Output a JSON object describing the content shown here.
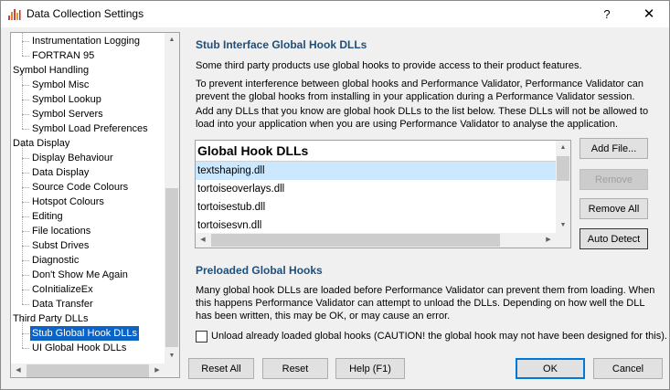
{
  "window": {
    "title": "Data Collection Settings",
    "help_glyph": "?",
    "close_glyph": "✕"
  },
  "tree": {
    "items": [
      {
        "label": "Instrumentation Logging",
        "level": 1
      },
      {
        "label": "FORTRAN 95",
        "level": 1
      },
      {
        "label": "Symbol Handling",
        "level": 0
      },
      {
        "label": "Symbol Misc",
        "level": 1
      },
      {
        "label": "Symbol Lookup",
        "level": 1
      },
      {
        "label": "Symbol Servers",
        "level": 1
      },
      {
        "label": "Symbol Load Preferences",
        "level": 1
      },
      {
        "label": "Data Display",
        "level": 0
      },
      {
        "label": "Display Behaviour",
        "level": 1
      },
      {
        "label": "Data Display",
        "level": 1
      },
      {
        "label": "Source Code Colours",
        "level": 1
      },
      {
        "label": "Hotspot Colours",
        "level": 1
      },
      {
        "label": "Editing",
        "level": 1
      },
      {
        "label": "File locations",
        "level": 1
      },
      {
        "label": "Subst Drives",
        "level": 1
      },
      {
        "label": "Diagnostic",
        "level": 1
      },
      {
        "label": "Don't Show Me Again",
        "level": 1
      },
      {
        "label": "CoInitializeEx",
        "level": 1
      },
      {
        "label": "Data Transfer",
        "level": 1
      },
      {
        "label": "Third Party DLLs",
        "level": 0
      },
      {
        "label": "Stub Global Hook DLLs",
        "level": 1,
        "selected": true
      },
      {
        "label": "UI Global Hook DLLs",
        "level": 1
      }
    ]
  },
  "stub": {
    "title": "Stub Interface Global Hook DLLs",
    "para1": "Some third party products use global hooks to provide access to their product features.",
    "para2": "To prevent interference between global hooks and Performance Validator, Performance Validator can prevent the global hooks from installing in your application during a Performance Validator session.",
    "para3": "Add any DLLs that you know are global hook DLLs to the list below. These DLLs will not be allowed to load into your application when you are using Performance Validator to analyse the application."
  },
  "list": {
    "header": "Global Hook DLLs",
    "rows": [
      "textshaping.dll",
      "tortoiseoverlays.dll",
      "tortoisestub.dll",
      "tortoisesvn.dll"
    ]
  },
  "buttons": {
    "add_file": "Add File...",
    "remove": "Remove",
    "remove_all": "Remove All",
    "auto_detect": "Auto Detect",
    "reset_all": "Reset All",
    "reset": "Reset",
    "help": "Help (F1)",
    "ok": "OK",
    "cancel": "Cancel"
  },
  "preloaded": {
    "title": "Preloaded Global Hooks",
    "para": "Many global hook DLLs are loaded before Performance Validator can prevent them from loading. When this happens Performance Validator can attempt to unload the DLLs. Depending on how well the DLL has been written, this may be OK, or may cause an error.",
    "checkbox_label": "Unload already loaded global hooks (CAUTION! the global hook may not have been designed for this).",
    "checkbox_checked": false
  },
  "colors": {
    "section_title": "#1f4e79",
    "tree_selected": "#0a64c8",
    "list_selected": "#cce8ff"
  }
}
